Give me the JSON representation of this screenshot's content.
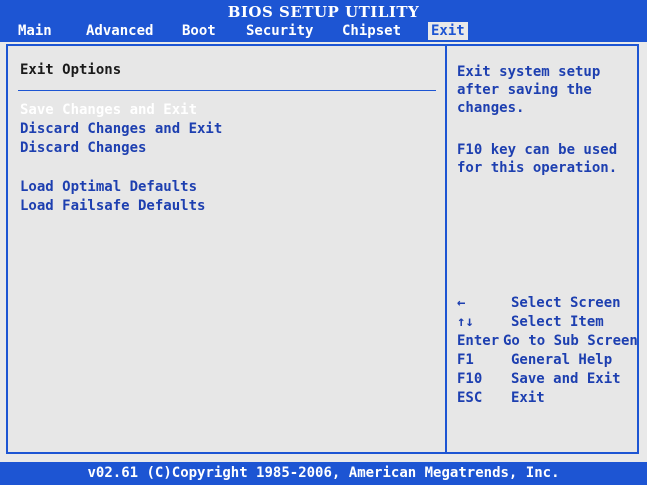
{
  "header": {
    "title": "BIOS SETUP UTILITY",
    "tabs": [
      {
        "label": "Main"
      },
      {
        "label": "Advanced"
      },
      {
        "label": "Boot"
      },
      {
        "label": "Security"
      },
      {
        "label": "Chipset"
      },
      {
        "label": "Exit",
        "active": true
      }
    ]
  },
  "main": {
    "section_title": "Exit Options",
    "options": [
      {
        "label": "Save Changes and Exit",
        "selected": true
      },
      {
        "label": "Discard Changes and Exit"
      },
      {
        "label": "Discard Changes"
      },
      {
        "label": "Load Optimal Defaults"
      },
      {
        "label": "Load Failsafe Defaults"
      }
    ]
  },
  "help": {
    "lines": [
      "Exit system setup",
      "after saving the",
      "changes."
    ],
    "note_lines": [
      "F10 key can be used",
      "for this operation."
    ]
  },
  "keys": [
    {
      "key": "←",
      "desc": "Select Screen",
      "icon": "left-arrow-icon"
    },
    {
      "key": "↑↓",
      "desc": "Select Item",
      "icon": "up-down-arrow-icon"
    },
    {
      "key": "Enter",
      "desc": "Go to Sub Screen"
    },
    {
      "key": "F1",
      "desc": "General Help"
    },
    {
      "key": "F10",
      "desc": "Save and Exit"
    },
    {
      "key": "ESC",
      "desc": "Exit"
    }
  ],
  "footer": {
    "copyright": "v02.61 (C)Copyright 1985-2006, American Megatrends, Inc."
  },
  "colors": {
    "accent": "#1d55d3",
    "background": "#e9e9e9",
    "text": "#1d3fb0",
    "selected": "#ffffff"
  }
}
